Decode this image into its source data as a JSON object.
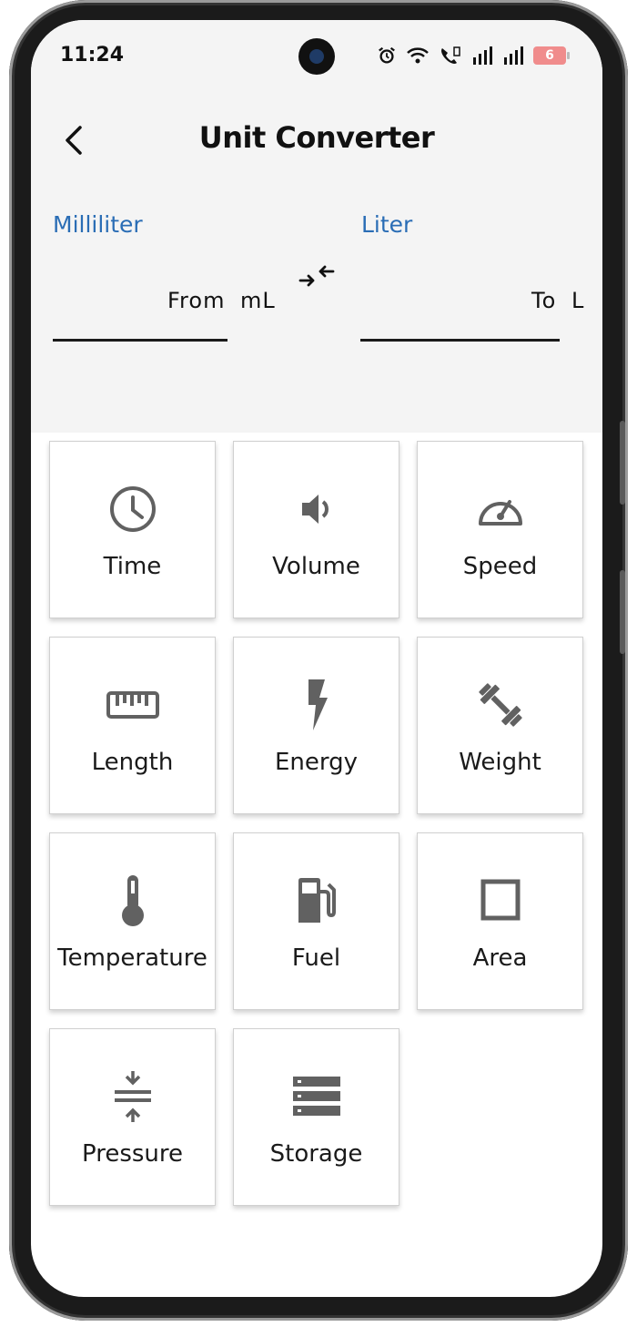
{
  "status_bar": {
    "time": "11:24",
    "battery": "6"
  },
  "header": {
    "title": "Unit Converter"
  },
  "converter": {
    "from_unit_name": "Milliliter",
    "to_unit_name": "Liter",
    "from_hint": "From",
    "from_suffix": "mL",
    "to_hint": "To",
    "to_suffix": "L",
    "from_value": "",
    "to_value": ""
  },
  "categories": [
    {
      "label": "Time",
      "icon": "clock-icon"
    },
    {
      "label": "Volume",
      "icon": "speaker-icon"
    },
    {
      "label": "Speed",
      "icon": "speedometer-icon"
    },
    {
      "label": "Length",
      "icon": "ruler-icon"
    },
    {
      "label": "Energy",
      "icon": "lightning-icon"
    },
    {
      "label": "Weight",
      "icon": "dumbbell-icon"
    },
    {
      "label": "Temperature",
      "icon": "thermometer-icon"
    },
    {
      "label": "Fuel",
      "icon": "fuel-pump-icon"
    },
    {
      "label": "Area",
      "icon": "square-icon"
    },
    {
      "label": "Pressure",
      "icon": "compress-icon"
    },
    {
      "label": "Storage",
      "icon": "storage-icon"
    }
  ],
  "colors": {
    "accent": "#2a6db5",
    "icon": "#616161",
    "header_bg": "#f4f4f4"
  }
}
